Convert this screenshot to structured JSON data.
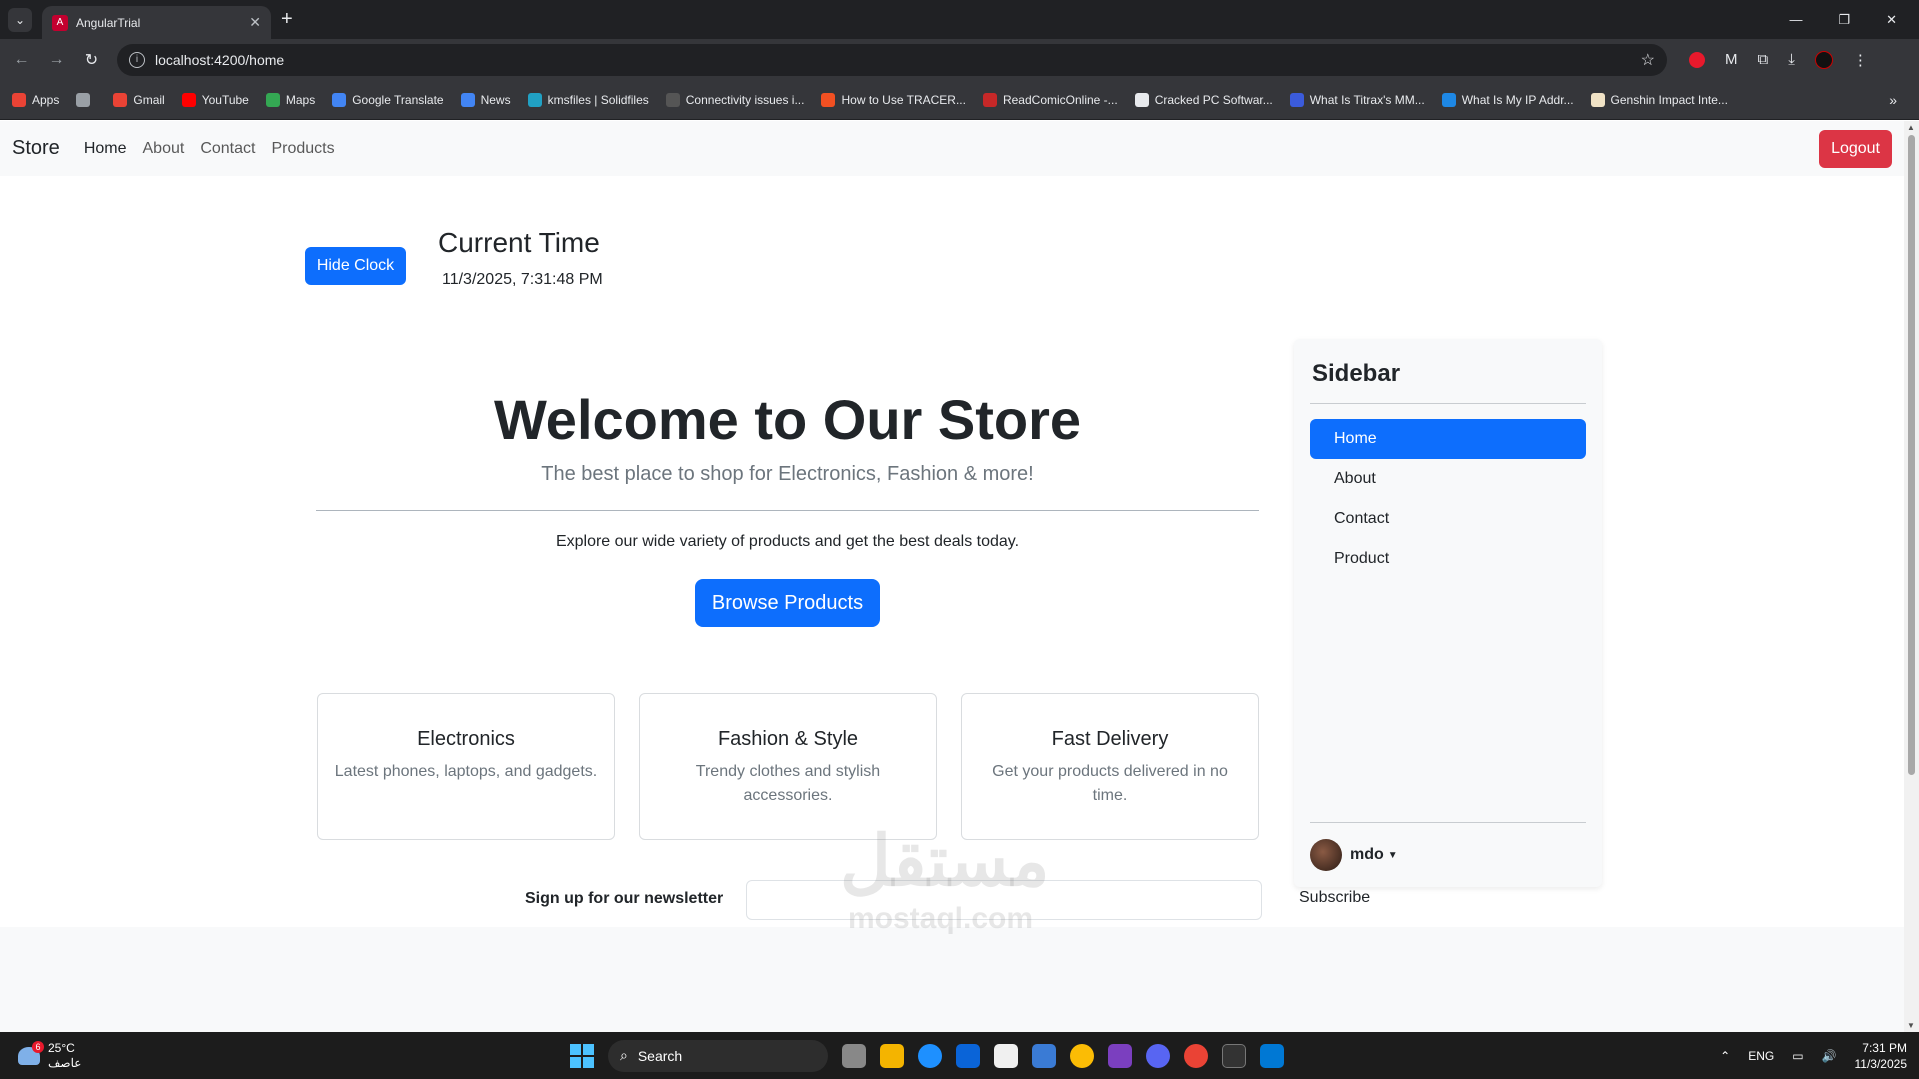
{
  "browser": {
    "tab_title": "AngularTrial",
    "url": "localhost:4200/home",
    "window_controls": [
      "—",
      "❐",
      "✕"
    ],
    "bookmarks": [
      {
        "label": "Apps",
        "color": "#ea4335"
      },
      {
        "label": "",
        "color": "#9aa0a6"
      },
      {
        "label": "Gmail",
        "color": "#ea4335"
      },
      {
        "label": "YouTube",
        "color": "#ff0000"
      },
      {
        "label": "Maps",
        "color": "#34a853"
      },
      {
        "label": "Google Translate",
        "color": "#4285f4"
      },
      {
        "label": "News",
        "color": "#4285f4"
      },
      {
        "label": "kmsfiles | Solidfiles",
        "color": "#21a1c4"
      },
      {
        "label": "Connectivity issues i...",
        "color": "#555555"
      },
      {
        "label": "How to Use TRACER...",
        "color": "#f25022"
      },
      {
        "label": "ReadComicOnline -...",
        "color": "#c62828"
      },
      {
        "label": "Cracked PC Softwar...",
        "color": "#e8eaed"
      },
      {
        "label": "What Is Titrax's MM...",
        "color": "#3b5bdb"
      },
      {
        "label": "What Is My IP Addr...",
        "color": "#1e88e5"
      },
      {
        "label": "Genshin Impact Inte...",
        "color": "#f1e3c6"
      }
    ]
  },
  "navbar": {
    "brand": "Store",
    "links": [
      "Home",
      "About",
      "Contact",
      "Products"
    ],
    "logout": "Logout"
  },
  "clock": {
    "button": "Hide Clock",
    "title": "Current Time",
    "time": "11/3/2025, 7:31:48 PM"
  },
  "hero": {
    "title": "Welcome to Our Store",
    "subtitle": "The best place to shop for Electronics, Fashion & more!",
    "description": "Explore our wide variety of products and get the best deals today.",
    "cta": "Browse Products"
  },
  "cards": [
    {
      "title": "Electronics",
      "text": "Latest phones, laptops, and gadgets."
    },
    {
      "title": "Fashion & Style",
      "text": "Trendy clothes and stylish accessories."
    },
    {
      "title": "Fast Delivery",
      "text": "Get your products delivered in no time."
    }
  ],
  "sidebar": {
    "title": "Sidebar",
    "items": [
      "Home",
      "About",
      "Contact",
      "Product"
    ],
    "user": "mdo"
  },
  "footer": {
    "newsletter_label": "Sign up for our newsletter",
    "subscribe": "Subscribe"
  },
  "watermark": {
    "arabic": "مستقل",
    "latin": "mostaql.com"
  },
  "taskbar": {
    "weather_temp": "25°C",
    "weather_desc": "عاصف",
    "weather_badge": "6",
    "search": "Search",
    "language": "ENG",
    "time": "7:31 PM",
    "date": "11/3/2025"
  }
}
